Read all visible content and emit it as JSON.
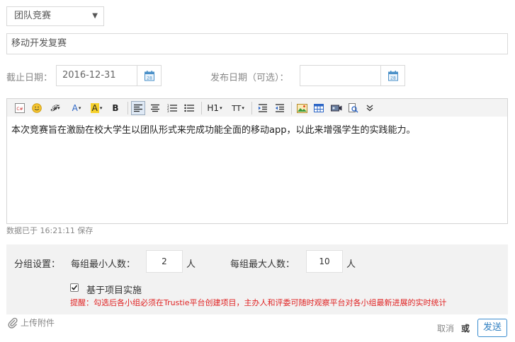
{
  "form": {
    "type_select": "团队竞赛",
    "title_value": "移动开发复赛",
    "deadline_label": "截止日期：",
    "deadline_value": "2016-12-31",
    "publish_label": "发布日期（可选）：",
    "publish_value": ""
  },
  "toolbar": {
    "heading_label": "H1",
    "font_size_label": "TT",
    "font_color_label": "A",
    "bg_color_label": "A",
    "bold_label": "B"
  },
  "editor": {
    "content": "本次竞赛旨在激励在校大学生以团队形式来完成功能全面的移动app，以此来增强学生的实践能力。"
  },
  "status": {
    "saved_text": "数据已于 16:21:11 保存"
  },
  "grouping": {
    "title": "分组设置：",
    "min_label": "每组最小人数：",
    "min_value": "2",
    "min_unit": "人",
    "max_label": "每组最大人数：",
    "max_value": "10",
    "max_unit": "人",
    "project_checkbox_label": "基于项目实施",
    "project_checked": true,
    "hint": "提醒：勾选后各小组必须在Trustie平台创建项目，主办人和评委可随时观察平台对各小组最新进展的实时统计"
  },
  "footer": {
    "upload_label": "上传附件",
    "cancel_label": "取消",
    "or_label": "或",
    "send_label": "发送"
  },
  "colors": {
    "hint": "#e02222",
    "send_border": "#3a8ccf"
  }
}
